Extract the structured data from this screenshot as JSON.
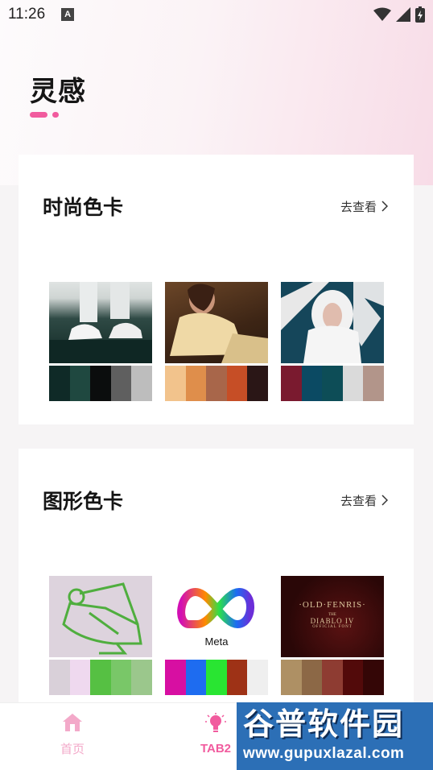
{
  "status_bar": {
    "time": "11:26",
    "notification_glyph": "A"
  },
  "page": {
    "title": "灵感"
  },
  "sections": [
    {
      "title": "时尚色卡",
      "link_label": "去查看",
      "items": [
        {
          "image": "sneakers-photo",
          "palette": [
            "#0f2a27",
            "#1f4840",
            "#0b0d0d",
            "#5f5f5f",
            "#bdbdbd"
          ]
        },
        {
          "image": "woman-gold-photo",
          "palette": [
            "#f2c38c",
            "#df8e4b",
            "#a8664a",
            "#c64e26",
            "#2a1616"
          ]
        },
        {
          "image": "white-hood-photo",
          "palette": [
            "#7a1a2f",
            "#0b4a63",
            "#0d4d57",
            "#dadada",
            "#b2958a"
          ]
        }
      ]
    },
    {
      "title": "图形色卡",
      "link_label": "去查看",
      "items": [
        {
          "image": "green-line-art",
          "palette": [
            "#d9d0d9",
            "#efd9ef",
            "#56c043",
            "#79c768",
            "#9bc78c"
          ]
        },
        {
          "image": "meta-logo",
          "caption": "Meta",
          "palette": [
            "#d70fa2",
            "#1e6cf0",
            "#29e532",
            "#9e3216",
            "#efefef"
          ]
        },
        {
          "image": "diablo-poster",
          "poster_lines": [
            "·OLD·FENRIS·",
            "THE",
            "DIABLO IV",
            "OFFICIAL FONT"
          ],
          "palette": [
            "#ae9064",
            "#8c6846",
            "#8e3c32",
            "#520a0a",
            "#340606"
          ]
        }
      ]
    }
  ],
  "bottom_nav": [
    {
      "label": "首页",
      "icon": "home-icon",
      "active": false
    },
    {
      "label": "TAB2",
      "icon": "lightbulb-icon",
      "active": true
    }
  ],
  "watermark": {
    "text": "谷普软件园",
    "url": "www.gupuxlazal.com"
  },
  "colors": {
    "accent": "#f15b9e",
    "inactive_nav": "#f3a9c9"
  }
}
